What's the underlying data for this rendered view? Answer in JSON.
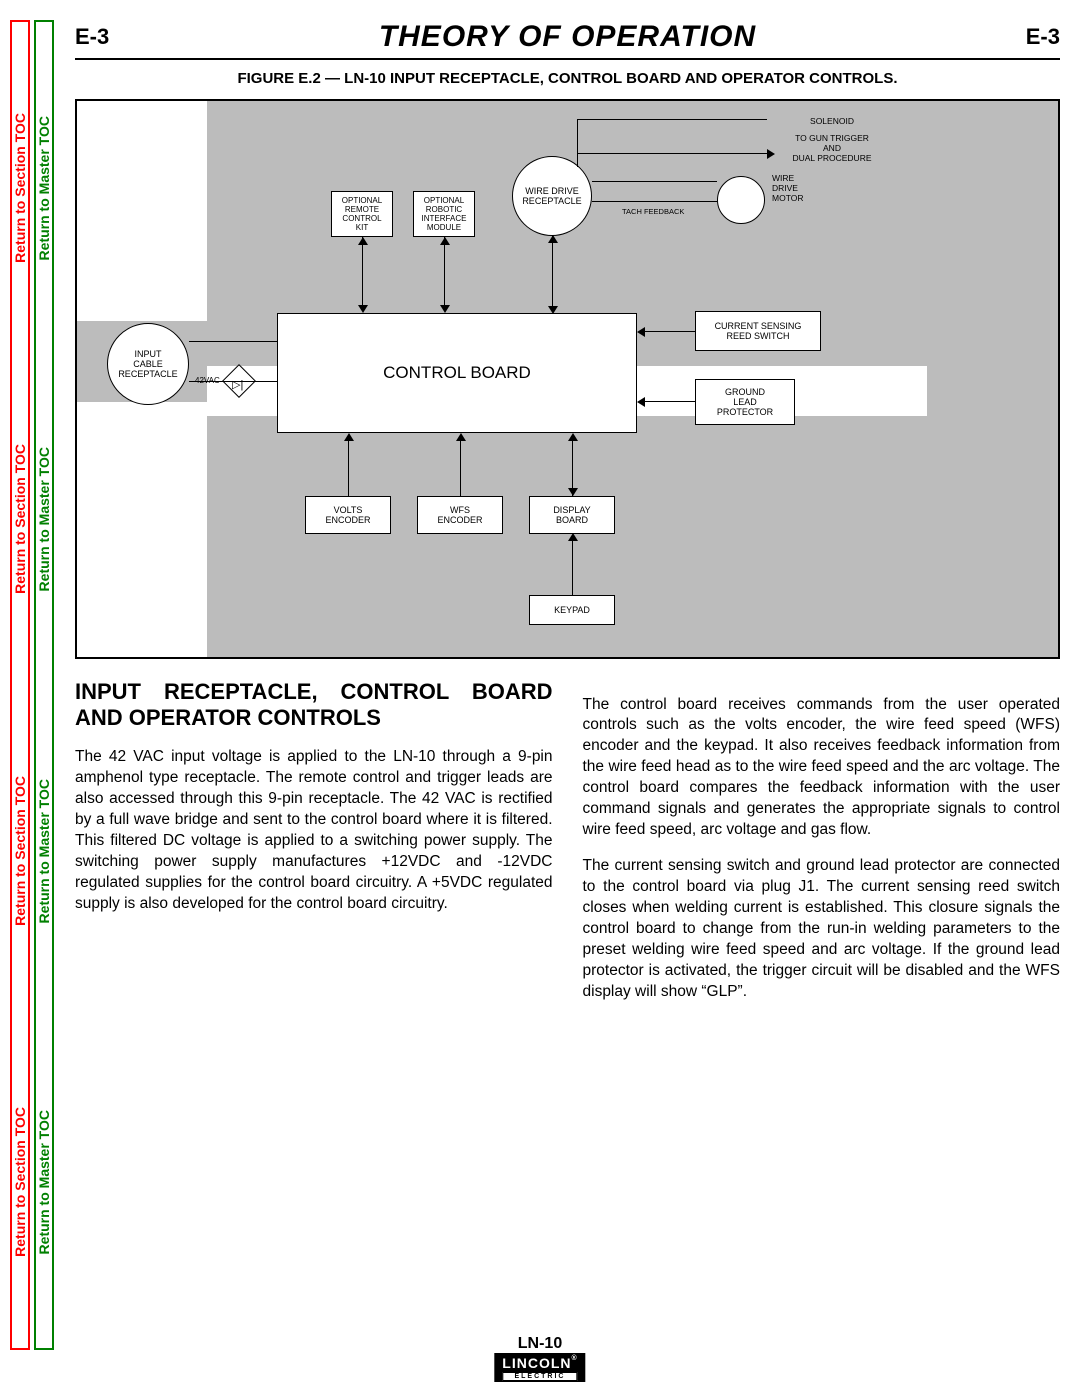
{
  "sidebar": {
    "section_toc": "Return to Section TOC",
    "master_toc": "Return to Master TOC"
  },
  "header": {
    "left": "E-3",
    "title": "THEORY OF OPERATION",
    "right": "E-3"
  },
  "figure_title": "FIGURE E.2 — LN-10 INPUT RECEPTACLE, CONTROL BOARD AND OPERATOR CONTROLS.",
  "diagram": {
    "control_board": "CONTROL BOARD",
    "input_cable": "INPUT\nCABLE\nRECEPTACLE",
    "ac_label": "42VAC",
    "remote_kit": "OPTIONAL\nREMOTE\nCONTROL\nKIT",
    "robotic": "OPTIONAL\nROBOTIC\nINTERFACE\nMODULE",
    "wire_drive_recept": "WIRE DRIVE\nRECEPTACLE",
    "solenoid": "SOLENOID",
    "gun_trigger": "TO GUN TRIGGER\nAND\nDUAL PROCEDURE",
    "wire_drive_motor": "WIRE\nDRIVE\nMOTOR",
    "tach_feedback": "TACH FEEDBACK",
    "current_sensing": "CURRENT  SENSING\nREED SWITCH",
    "ground_lead": "GROUND\nLEAD\nPROTECTOR",
    "volts_encoder": "VOLTS\nENCODER",
    "wfs_encoder": "WFS\nENCODER",
    "display_board": "DISPLAY\nBOARD",
    "keypad": "KEYPAD"
  },
  "section": {
    "heading": "INPUT RECEPTACLE, CONTROL BOARD AND OPERATOR CONTROLS",
    "p1": "The 42 VAC input voltage is applied to the LN-10 through a 9-pin amphenol type receptacle. The remote control and trigger leads are also accessed through this 9-pin receptacle. The 42 VAC is rectified by a full wave bridge and sent to the control board where it is filtered. This filtered DC voltage is applied to a switching power supply. The switching power supply manufactures +12VDC and -12VDC regulated supplies for the control board circuitry. A +5VDC regulated supply is also developed for the control board circuitry.",
    "p2": "The control board receives commands from the user operated controls such as the volts encoder, the wire feed speed (WFS) encoder and the keypad.  It also receives feedback information from the wire feed head as to the wire feed speed and the arc voltage. The control board compares the feedback information with the user command signals and generates the appropriate signals to control wire feed speed, arc voltage and gas flow.",
    "p3": "The current sensing switch and ground lead protector are connected to the control board via plug J1. The current sensing reed switch closes when welding current is established.  This closure signals the control board to change from the run-in welding parameters to the preset welding wire feed speed and arc voltage. If the ground lead protector is activated, the trigger circuit will be disabled and the WFS display will show “GLP”."
  },
  "footer": {
    "model": "LN-10",
    "logo": "LINCOLN",
    "logo_sub": "ELECTRIC"
  }
}
